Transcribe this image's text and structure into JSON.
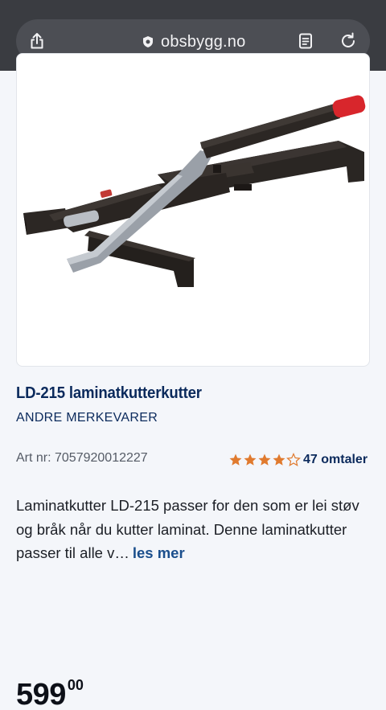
{
  "browser": {
    "url": "obsbygg.no",
    "icons": [
      "share-icon",
      "shield-icon",
      "reader-icon",
      "reload-icon"
    ]
  },
  "product": {
    "title": "LD-215 laminatkutterkutter",
    "brand": "ANDRE MERKEVARER",
    "art_nr": "Art nr: 7057920012227",
    "rating": {
      "value": 4,
      "max": 5,
      "reviews_label": "47 omtaler"
    },
    "description": "Laminatkutter LD-215 passer for den som er lei støv og bråk når du kutter laminat. Denne laminatkutter passer til alle v…",
    "read_more": "les mer",
    "price_main": "599",
    "price_decimals": "00"
  },
  "colors": {
    "topbar": "#3a3c41",
    "brand_blue": "#0b2a5c",
    "link_blue": "#1a4e8c",
    "star_orange": "#e07a2e"
  }
}
